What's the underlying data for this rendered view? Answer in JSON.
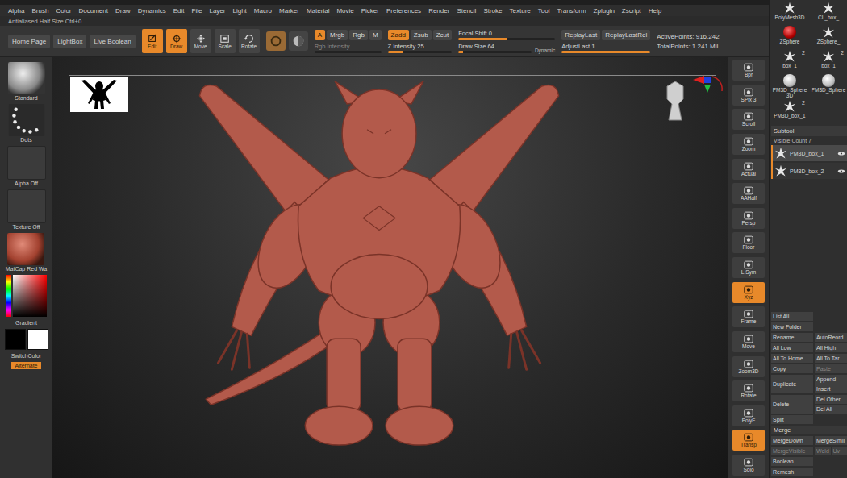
{
  "menu": [
    "Alpha",
    "Brush",
    "Color",
    "Document",
    "Draw",
    "Dynamics",
    "Edit",
    "File",
    "Layer",
    "Light",
    "Macro",
    "Marker",
    "Material",
    "Movie",
    "Picker",
    "Preferences",
    "Render",
    "Stencil",
    "Stroke",
    "Texture",
    "Tool",
    "Transform",
    "Zplugin",
    "Zscript",
    "Help"
  ],
  "subtitle": "Antialiased Half Size  Ctrl+0",
  "toolbar": {
    "nav_buttons": [
      "Home Page",
      "LightBox",
      "Live Boolean"
    ],
    "modes": [
      {
        "label": "Edit",
        "kind": "edit",
        "selected": true
      },
      {
        "label": "Draw",
        "kind": "draw",
        "selected": true
      },
      {
        "label": "Move",
        "kind": "move",
        "selected": false
      },
      {
        "label": "Scale",
        "kind": "scale",
        "selected": false
      },
      {
        "label": "Rotate",
        "kind": "rotate",
        "selected": false
      }
    ],
    "rgb": {
      "buttons": [
        {
          "label": "A",
          "selected": true
        },
        {
          "label": "Mrgb",
          "selected": false
        },
        {
          "label": "Rgb",
          "selected": false
        },
        {
          "label": "M",
          "selected": false
        }
      ],
      "slider": {
        "label": "Rgb Intensity",
        "level": 0,
        "disabled": true
      }
    },
    "z": {
      "buttons": [
        {
          "label": "Zadd",
          "selected": true
        },
        {
          "label": "Zsub",
          "selected": false
        },
        {
          "label": "Zcut",
          "selected": false
        }
      ],
      "slider": {
        "label": "Z Intensity 25",
        "level": 0.25,
        "disabled": false
      }
    },
    "focal": {
      "label": "Focal Shift 0",
      "level": 0.5
    },
    "draw_size": {
      "label": "Draw Size 64",
      "level": 0.06,
      "dynamic": "Dynamic"
    },
    "replay": [
      "ReplayLast",
      "ReplayLastRel"
    ],
    "adjust": {
      "label": "AdjustLast 1",
      "level": 1
    },
    "stats": [
      "ActivePoints: 916,242",
      "TotalPoints: 1.241 Mil"
    ]
  },
  "left_shelf": {
    "brush": "Standard",
    "stroke": "Dots",
    "alpha": "Alpha Off",
    "texture": "Texture Off",
    "material": "MatCap Red Wa",
    "gradient": "Gradient",
    "swatches": [
      {
        "color": "#000000"
      },
      {
        "color": "#ffffff"
      }
    ],
    "switch": "SwitchColor",
    "alternate": {
      "label": "Alternate",
      "selected": true
    }
  },
  "right_shelf": [
    {
      "label": "Bpr",
      "selected": false
    },
    {
      "label": "SPix 3",
      "selected": false
    },
    {
      "label": "Scroll",
      "selected": false
    },
    {
      "label": "Zoom",
      "selected": false
    },
    {
      "label": "Actual",
      "selected": false
    },
    {
      "label": "AAHalf",
      "selected": false
    },
    {
      "label": "Persp",
      "selected": false
    },
    {
      "label": "Floor",
      "selected": false
    },
    {
      "label": "L.Sym",
      "selected": false
    },
    {
      "label": "Xyz",
      "selected": true
    },
    {
      "label": "Frame",
      "selected": false
    },
    {
      "label": "Move",
      "selected": false
    },
    {
      "label": "Zoom3D",
      "selected": false
    },
    {
      "label": "Rotate",
      "selected": false
    },
    {
      "label": "PolyF",
      "selected": false
    },
    {
      "label": "Transp",
      "selected": true
    },
    {
      "label": "Solo",
      "selected": false
    }
  ],
  "tools": [
    {
      "label": "PolyMesh3D",
      "kind": "star"
    },
    {
      "label": "CL_box_",
      "kind": "star"
    },
    {
      "label": "ZSphere",
      "kind": "sphere-red"
    },
    {
      "label": "ZSphere_",
      "kind": "star"
    },
    {
      "label": "box_1",
      "kind": "star",
      "count": "2"
    },
    {
      "label": "box_1",
      "kind": "star",
      "count": "2"
    },
    {
      "label": "PM3D_Sphere3D",
      "kind": "sphere-white"
    },
    {
      "label": "PM3D_Sphere",
      "kind": "sphere-white"
    },
    {
      "label": "PM3D_box_1",
      "kind": "star",
      "count": "2"
    }
  ],
  "subtool": {
    "title": "Subtool",
    "visible_count": "Visible Count 7",
    "items": [
      {
        "label": "PM3D_box_1",
        "selected": true
      },
      {
        "label": "PM3D_box_2",
        "selected": false
      }
    ],
    "rows": [
      {
        "left": {
          "label": "List All",
          "disabled": false
        },
        "right": []
      },
      {
        "left": {
          "label": "New Folder",
          "disabled": false
        },
        "right": []
      },
      {
        "left": {
          "label": "Rename",
          "disabled": false
        },
        "right": [
          {
            "label": "AutoReord",
            "disabled": false
          }
        ]
      },
      {
        "left": {
          "label": "All Low",
          "disabled": false
        },
        "right": [
          {
            "label": "All High",
            "disabled": false
          }
        ]
      },
      {
        "left": {
          "label": "All To Home",
          "disabled": false
        },
        "right": [
          {
            "label": "All To Tar",
            "disabled": false
          }
        ]
      },
      {
        "left": {
          "label": "Copy",
          "disabled": false
        },
        "right": [
          {
            "label": "Paste",
            "disabled": true
          }
        ]
      },
      {
        "left": {
          "label": "Duplicate",
          "disabled": false
        },
        "right": [
          {
            "label": "Append",
            "disabled": false
          },
          {
            "label": "Insert",
            "disabled": false
          }
        ]
      },
      {
        "left": {
          "label": "Delete",
          "disabled": false
        },
        "right": [
          {
            "label": "Del Other",
            "disabled": false
          },
          {
            "label": "Del All",
            "disabled": false
          }
        ]
      },
      {
        "left": {
          "label": "Split",
          "disabled": false
        },
        "right": []
      }
    ],
    "merge_title": "Merge",
    "merge_rows": [
      {
        "left": {
          "label": "MergeDown",
          "disabled": false
        },
        "right": [
          {
            "label": "MergeSimil",
            "disabled": false
          }
        ]
      },
      {
        "left": {
          "label": "MergeVisible",
          "disabled": true
        },
        "right": [
          {
            "label": "Weld",
            "disabled": true
          },
          {
            "label": "Uv",
            "disabled": true
          }
        ]
      },
      {
        "left": {
          "label": "Boolean",
          "disabled": false
        },
        "right": []
      },
      {
        "left": {
          "label": "Remesh",
          "disabled": false
        },
        "right": []
      }
    ]
  }
}
